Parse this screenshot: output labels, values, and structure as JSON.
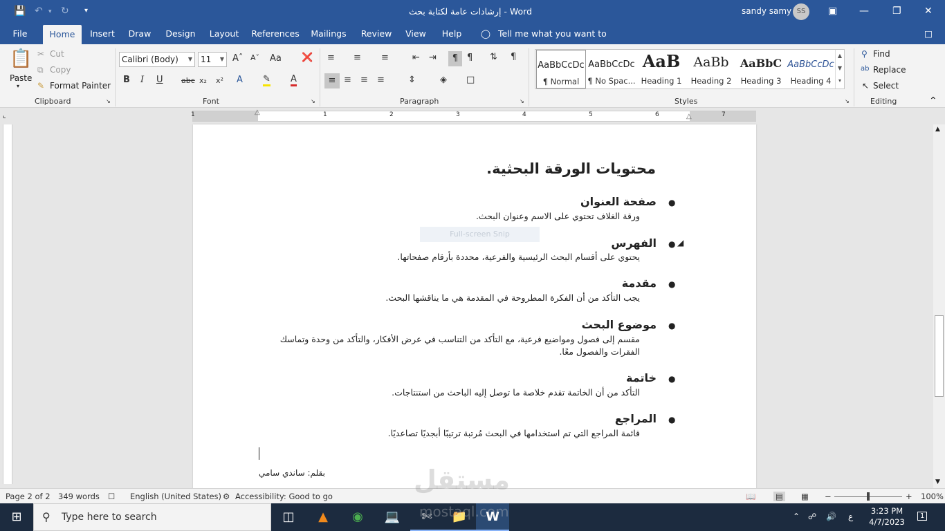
{
  "titlebar": {
    "doc_title": "إرشادات عامة لكتابة بحث",
    "app_name": "Word",
    "separator": "-",
    "user_name": "sandy samy",
    "user_initials": "SS"
  },
  "menu": {
    "file": "File",
    "home": "Home",
    "insert": "Insert",
    "draw": "Draw",
    "design": "Design",
    "layout": "Layout",
    "references": "References",
    "mailings": "Mailings",
    "review": "Review",
    "view": "View",
    "help": "Help",
    "tell_me": "Tell me what you want to do"
  },
  "clipboard": {
    "paste": "Paste",
    "cut": "Cut",
    "copy": "Copy",
    "format_painter": "Format Painter",
    "label": "Clipboard"
  },
  "font": {
    "family": "Calibri (Body)",
    "size": "11",
    "label": "Font"
  },
  "paragraph": {
    "label": "Paragraph"
  },
  "styles": {
    "label": "Styles",
    "items": [
      {
        "sample": "AaBbCcDc",
        "name": "¶ Normal"
      },
      {
        "sample": "AaBbCcDc",
        "name": "¶ No Spac..."
      },
      {
        "sample": "AaB",
        "name": "Heading 1"
      },
      {
        "sample": "AaBb",
        "name": "Heading 2"
      },
      {
        "sample": "AaBbC",
        "name": "Heading 3"
      },
      {
        "sample": "AaBbCcDc",
        "name": "Heading 4"
      }
    ]
  },
  "editing": {
    "find": "Find",
    "replace": "Replace",
    "select": "Select",
    "label": "Editing"
  },
  "ruler": {
    "numbers": [
      "1",
      "1",
      "2",
      "3",
      "4",
      "5",
      "6",
      "7"
    ]
  },
  "document": {
    "title": "محتويات الورقة البحثية.",
    "sections": [
      {
        "heading": "صفحة العنوان",
        "body": "ورقة الغلاف تحتوي على الاسم وعنوان البحث."
      },
      {
        "heading": "الفهرس",
        "body": "يحتوي على أقسام البحث الرئيسية والفرعية، محددة بأرقام صفحاتها."
      },
      {
        "heading": "مقدمة",
        "body": "يجب التأكد من أن الفكرة المطروحة في المقدمة هي ما يناقشها البحث."
      },
      {
        "heading": "موضوع البحث",
        "body": "مقسم إلى فصول ومواضيع فرعية، مع التأكد من التناسب في عرض الأفكار، والتأكد من وحدة وتماسك الفقرات والفصول معًا."
      },
      {
        "heading": "خاتمة",
        "body": "التأكد من أن الخاتمة تقدم خلاصة ما توصل إليه الباحث من استنتاجات."
      },
      {
        "heading": "المراجع",
        "body": "قائمة المراجع التي تم استخدامها في البحث مُرتبة ترتيبًا أبجديًا تصاعديًا."
      }
    ],
    "byline": "بقلم: ساندي سامي",
    "snip_overlay": "Full-screen Snip"
  },
  "status": {
    "page": "Page 2 of 2",
    "words": "349 words",
    "language": "English (United States)",
    "accessibility": "Accessibility: Good to go",
    "zoom": "100%"
  },
  "taskbar": {
    "search_placeholder": "Type here to search",
    "time": "3:23 PM",
    "date": "4/7/2023",
    "lang": "ع",
    "notifications": "1"
  },
  "watermark": {
    "text": "مستقل",
    "sub": "mostaql.com"
  },
  "colors": {
    "accent": "#2b579a",
    "taskbar": "#1c2b3f"
  }
}
